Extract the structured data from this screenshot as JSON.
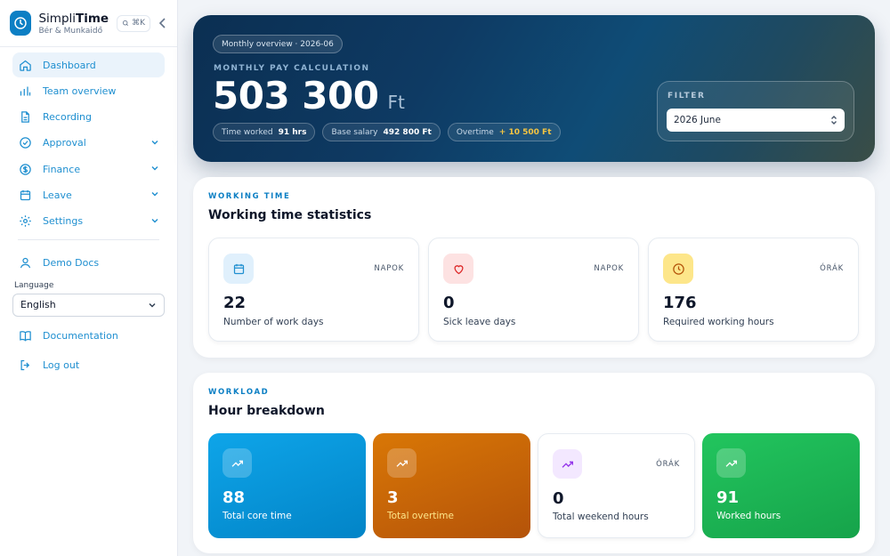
{
  "brand": {
    "name_light": "Simpli",
    "name_bold": "Time",
    "subtitle": "Bér & Munkaidő",
    "shortcut": "⌘K"
  },
  "sidebar": {
    "items": [
      {
        "label": "Dashboard",
        "icon": "home-icon",
        "active": true
      },
      {
        "label": "Team overview",
        "icon": "bar-chart-icon"
      },
      {
        "label": "Recording",
        "icon": "document-icon"
      },
      {
        "label": "Approval",
        "icon": "check-circle-icon",
        "expandable": true
      },
      {
        "label": "Finance",
        "icon": "dollar-circle-icon",
        "expandable": true
      },
      {
        "label": "Leave",
        "icon": "calendar-icon",
        "expandable": true
      },
      {
        "label": "Settings",
        "icon": "gear-icon",
        "expandable": true
      }
    ],
    "demo_docs": "Demo Docs",
    "language_label": "Language",
    "language_value": "English",
    "documentation": "Documentation",
    "logout": "Log out"
  },
  "hero": {
    "pill": "Monthly overview · 2026-06",
    "eyebrow": "MONTHLY PAY CALCULATION",
    "amount": "503 300",
    "currency": "Ft",
    "chips": [
      {
        "label": "Time worked",
        "value": "91 hrs"
      },
      {
        "label": "Base salary",
        "value": "492 800 Ft"
      },
      {
        "label": "Overtime",
        "value": "+ 10 500 Ft"
      }
    ],
    "filter_label": "FILTER",
    "filter_value": "2026 June"
  },
  "working_time": {
    "eyebrow": "WORKING TIME",
    "title": "Working time statistics",
    "cards": [
      {
        "unit": "NAPOK",
        "value": "22",
        "label": "Number of work days",
        "icon": "calendar-icon"
      },
      {
        "unit": "NAPOK",
        "value": "0",
        "label": "Sick leave days",
        "icon": "heart-icon"
      },
      {
        "unit": "ÓRÁK",
        "value": "176",
        "label": "Required working hours",
        "icon": "clock-icon"
      }
    ]
  },
  "workload": {
    "eyebrow": "WORKLOAD",
    "title": "Hour breakdown",
    "cards": [
      {
        "value": "88",
        "label": "Total core time",
        "icon": "trending-up-icon"
      },
      {
        "value": "3",
        "label": "Total overtime",
        "icon": "trending-up-icon"
      },
      {
        "unit": "ÓRÁK",
        "value": "0",
        "label": "Total weekend hours",
        "icon": "trending-up-icon"
      },
      {
        "value": "91",
        "label": "Worked hours",
        "icon": "trending-up-icon"
      }
    ]
  },
  "colors": {
    "accent": "#0c7fc4",
    "blue_card": "#0ea5e9",
    "orange_card": "#d9770f",
    "green_card": "#16a34a",
    "gold": "#f5c542"
  }
}
